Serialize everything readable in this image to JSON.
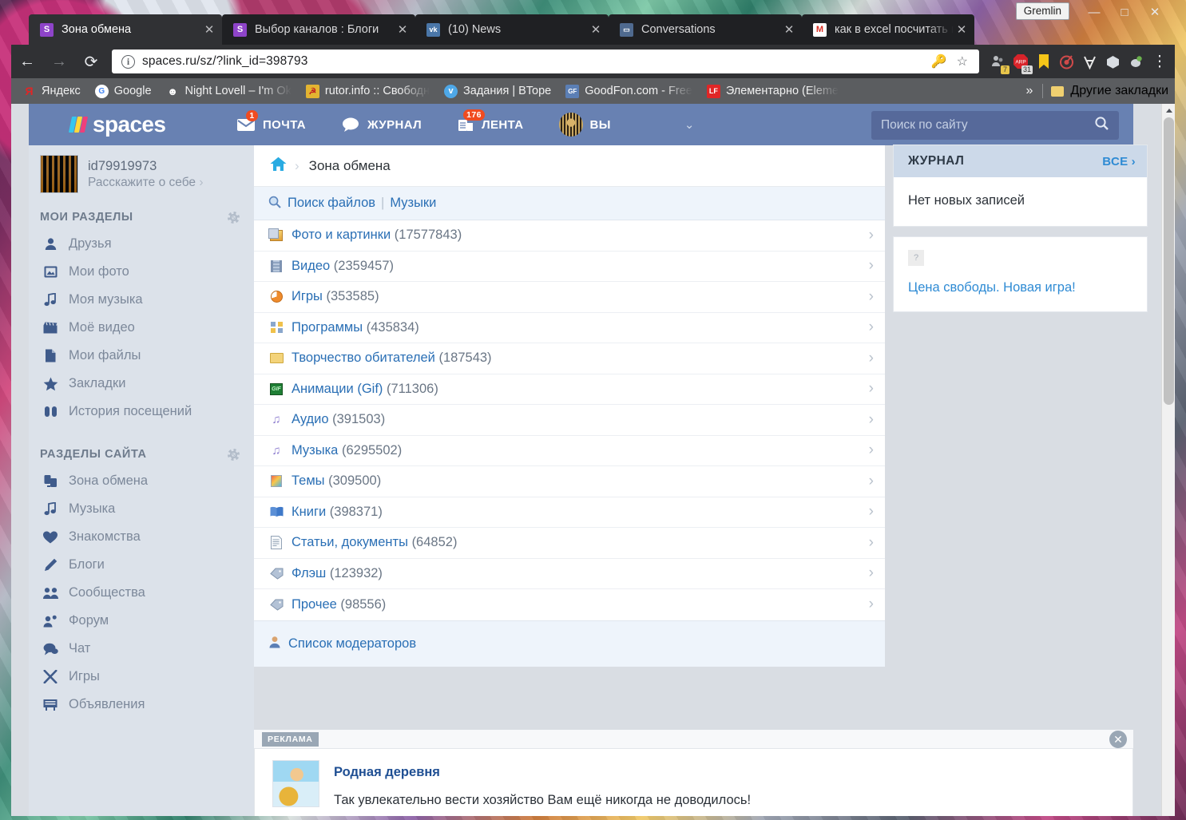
{
  "window": {
    "gremlin_label": "Gremlin",
    "minimize": "—",
    "maximize": "□",
    "close": "✕"
  },
  "tabs": [
    {
      "title": "Зона обмена",
      "favicon_name": "spaces-favicon",
      "favicon_letter": "S",
      "favicon_color": "#8e44c9",
      "active": true,
      "close": "✕"
    },
    {
      "title": "Выбор каналов : Блоги",
      "favicon_name": "spaces-favicon",
      "favicon_letter": "S",
      "favicon_color": "#8e44c9",
      "active": false,
      "close": "✕"
    },
    {
      "title": "(10) News",
      "favicon_name": "vk-favicon",
      "favicon_letter": "vk",
      "favicon_color": "#4a76a8",
      "active": false,
      "close": "✕"
    },
    {
      "title": "Conversations",
      "favicon_name": "conversations-favicon",
      "favicon_letter": "💬",
      "favicon_color": "#4f6a8f",
      "active": false,
      "close": "✕"
    },
    {
      "title": "как в excel посчитать пр",
      "favicon_name": "gmail-favicon",
      "favicon_letter": "M",
      "favicon_color": "#ffffff",
      "active": false,
      "close": "✕"
    }
  ],
  "toolbar": {
    "back_icon": "←",
    "forward_icon": "→",
    "reload_icon": "⟳",
    "url_scheme_icon": "info-icon",
    "url": "spaces.ru/sz/?link_id=398793",
    "url_host": "spaces.ru",
    "url_path": "/sz/?link_id=398793",
    "save_password_icon": "🔑",
    "bookmark_star_icon": "☆",
    "menu_icon": "⋮",
    "extensions": [
      {
        "name": "people-extension",
        "badge": "7",
        "color": "#b9bcc0"
      },
      {
        "name": "arp-adblock-extension",
        "badge": "31",
        "color": "#d8232a",
        "letter": "ARP"
      },
      {
        "name": "bookmark-extension",
        "badge": "",
        "color": "#f5c518"
      },
      {
        "name": "target-extension",
        "badge": "",
        "color": "#d14a4a"
      },
      {
        "name": "vpn-extension",
        "badge": "",
        "color": "#e8e8e8"
      },
      {
        "name": "cube-extension",
        "badge": "",
        "color": "#d9dde2"
      },
      {
        "name": "shield-extension",
        "badge": "",
        "color": "#cfd4d9"
      }
    ]
  },
  "bookmarks": {
    "items": [
      {
        "label": "Яндекс",
        "icon_name": "yandex-icon",
        "letter": "Я",
        "color": "#e02626",
        "bg": "transparent"
      },
      {
        "label": "Google",
        "icon_name": "google-icon",
        "letter": "G",
        "color": "#4285f4",
        "bg": "#ffffff"
      },
      {
        "label": "Night Lovell – I'm Ok",
        "icon_name": "music-icon",
        "letter": "♪",
        "color": "#ffffff",
        "bg": "transparent",
        "faded": true
      },
      {
        "label": "rutor.info :: Свободн",
        "icon_name": "rutor-icon",
        "letter": "★",
        "color": "#e8c24a",
        "bg": "#d8a12a",
        "faded": true
      },
      {
        "label": "Задания | BTopе",
        "icon_name": "vtope-icon",
        "letter": "v",
        "color": "#ffffff",
        "bg": "#4ea8e8"
      },
      {
        "label": "GoodFon.com - Free",
        "icon_name": "goodfon-icon",
        "letter": "GF",
        "color": "#ffffff",
        "bg": "#5b7fb5",
        "faded": true
      },
      {
        "label": "Элементарно (Eleme",
        "icon_name": "lostfilm-icon",
        "letter": "LF",
        "color": "#ffffff",
        "bg": "#e02626",
        "faded": true
      }
    ],
    "overflow_icon": "»",
    "other_bookmarks": "Другие закладки",
    "other_bookmarks_icon": "folder-icon"
  },
  "site": {
    "logo_text": "spaces",
    "nav": [
      {
        "label": "ПОЧТА",
        "icon_name": "mail-icon",
        "glyph": "✉",
        "badge": "1"
      },
      {
        "label": "ЖУРНАЛ",
        "icon_name": "chat-bubble-icon",
        "glyph": "💬",
        "badge": ""
      },
      {
        "label": "ЛЕНТА",
        "icon_name": "feed-icon",
        "glyph": "🗞",
        "badge": "176"
      },
      {
        "label": "ВЫ",
        "icon_name": "user-avatar-icon",
        "glyph": "",
        "badge": ""
      }
    ],
    "nav_chevron_icon": "⌄",
    "search_placeholder": "Поиск по сайту",
    "search_value": "",
    "search_icon": "search-icon",
    "header_color": "#6881b2",
    "search_box_color": "#56699a"
  },
  "sidebar": {
    "profile": {
      "name": "id79919973",
      "subtitle": "Расскажите о себе",
      "subtitle_arrow": "›",
      "avatar_name": "profile-avatar"
    },
    "my_sections_title": "МОИ РАЗДЕЛЫ",
    "my_sections_gear": "gear-icon",
    "my_sections": [
      {
        "label": "Друзья",
        "icon_name": "person-icon",
        "glyph": "👤"
      },
      {
        "label": "Мои фото",
        "icon_name": "photo-icon",
        "glyph": "🖼"
      },
      {
        "label": "Моя музыка",
        "icon_name": "music-note-icon",
        "glyph": "♫"
      },
      {
        "label": "Моё видео",
        "icon_name": "clapperboard-icon",
        "glyph": "🎬"
      },
      {
        "label": "Мои файлы",
        "icon_name": "file-icon",
        "glyph": "📄"
      },
      {
        "label": "Закладки",
        "icon_name": "star-icon",
        "glyph": "★"
      },
      {
        "label": "История посещений",
        "icon_name": "footprints-icon",
        "glyph": "👣"
      }
    ],
    "site_sections_title": "РАЗДЕЛЫ САЙТА",
    "site_sections_gear": "gear-icon",
    "site_sections": [
      {
        "label": "Зона обмена",
        "icon_name": "exchange-icon",
        "glyph": "⇄"
      },
      {
        "label": "Музыка",
        "icon_name": "music-note-icon",
        "glyph": "♫"
      },
      {
        "label": "Знакомства",
        "icon_name": "heart-icon",
        "glyph": "❤"
      },
      {
        "label": "Блоги",
        "icon_name": "pen-icon",
        "glyph": "✎"
      },
      {
        "label": "Сообщества",
        "icon_name": "group-icon",
        "glyph": "👥"
      },
      {
        "label": "Форум",
        "icon_name": "forum-icon",
        "glyph": "👤"
      },
      {
        "label": "Чат",
        "icon_name": "chat-icon",
        "glyph": "💬"
      },
      {
        "label": "Игры",
        "icon_name": "games-icon",
        "glyph": "✕"
      },
      {
        "label": "Объявления",
        "icon_name": "board-icon",
        "glyph": "🗒"
      }
    ]
  },
  "main": {
    "breadcrumb": {
      "home_icon": "home-icon",
      "separator": "›",
      "current": "Зона обмена"
    },
    "file_search": {
      "icon_name": "magnifier-icon",
      "link1": "Поиск файлов",
      "divider": "|",
      "link2": "Музыки"
    },
    "categories": [
      {
        "label": "Фото и картинки",
        "count": "(17577843)",
        "icon_name": "photo-icon",
        "icon_class": "ic-photo"
      },
      {
        "label": "Видео",
        "count": "(2359457)",
        "icon_name": "film-icon",
        "icon_class": "ic-video"
      },
      {
        "label": "Игры",
        "count": "(353585)",
        "icon_name": "game-icon",
        "icon_class": "ic-games"
      },
      {
        "label": "Программы",
        "count": "(435834)",
        "icon_name": "programs-icon",
        "icon_class": "ic-prog"
      },
      {
        "label": "Творчество обитателей",
        "count": "(187543)",
        "icon_name": "folder-icon",
        "icon_class": "ic-folder"
      },
      {
        "label": "Анимации (Gif)",
        "count": "(711306)",
        "icon_name": "gif-icon",
        "icon_class": "ic-gif"
      },
      {
        "label": "Аудио",
        "count": "(391503)",
        "icon_name": "audio-note-icon",
        "icon_class": "ic-note"
      },
      {
        "label": "Музыка",
        "count": "(6295502)",
        "icon_name": "music-note-icon",
        "icon_class": "ic-note"
      },
      {
        "label": "Темы",
        "count": "(309500)",
        "icon_name": "theme-icon",
        "icon_class": "ic-theme"
      },
      {
        "label": "Книги",
        "count": "(398371)",
        "icon_name": "book-icon",
        "icon_class": "ic-book"
      },
      {
        "label": "Статьи, документы",
        "count": "(64852)",
        "icon_name": "document-icon",
        "icon_class": "ic-doc"
      },
      {
        "label": "Флэш",
        "count": "(123932)",
        "icon_name": "tag-icon",
        "icon_class": "ic-tag"
      },
      {
        "label": "Прочее",
        "count": "(98556)",
        "icon_name": "tag-icon",
        "icon_class": "ic-tag"
      }
    ],
    "row_arrow": "›",
    "moderators": {
      "label": "Список модераторов",
      "icon_name": "moderator-icon"
    }
  },
  "ad": {
    "label": "РЕКЛАМА",
    "close_icon": "✕",
    "title": "Родная деревня",
    "text": "Так увлекательно вести хозяйство Вам ещё никогда не доводилось!",
    "thumb_name": "ad-thumbnail"
  },
  "right": {
    "journal": {
      "title": "ЖУРНАЛ",
      "all_label": "ВСЕ",
      "all_arrow": "›",
      "empty_text": "Нет новых записей"
    },
    "game_promo": {
      "placeholder_glyph": "?",
      "link": "Цена свободы. Новая игра!"
    }
  }
}
